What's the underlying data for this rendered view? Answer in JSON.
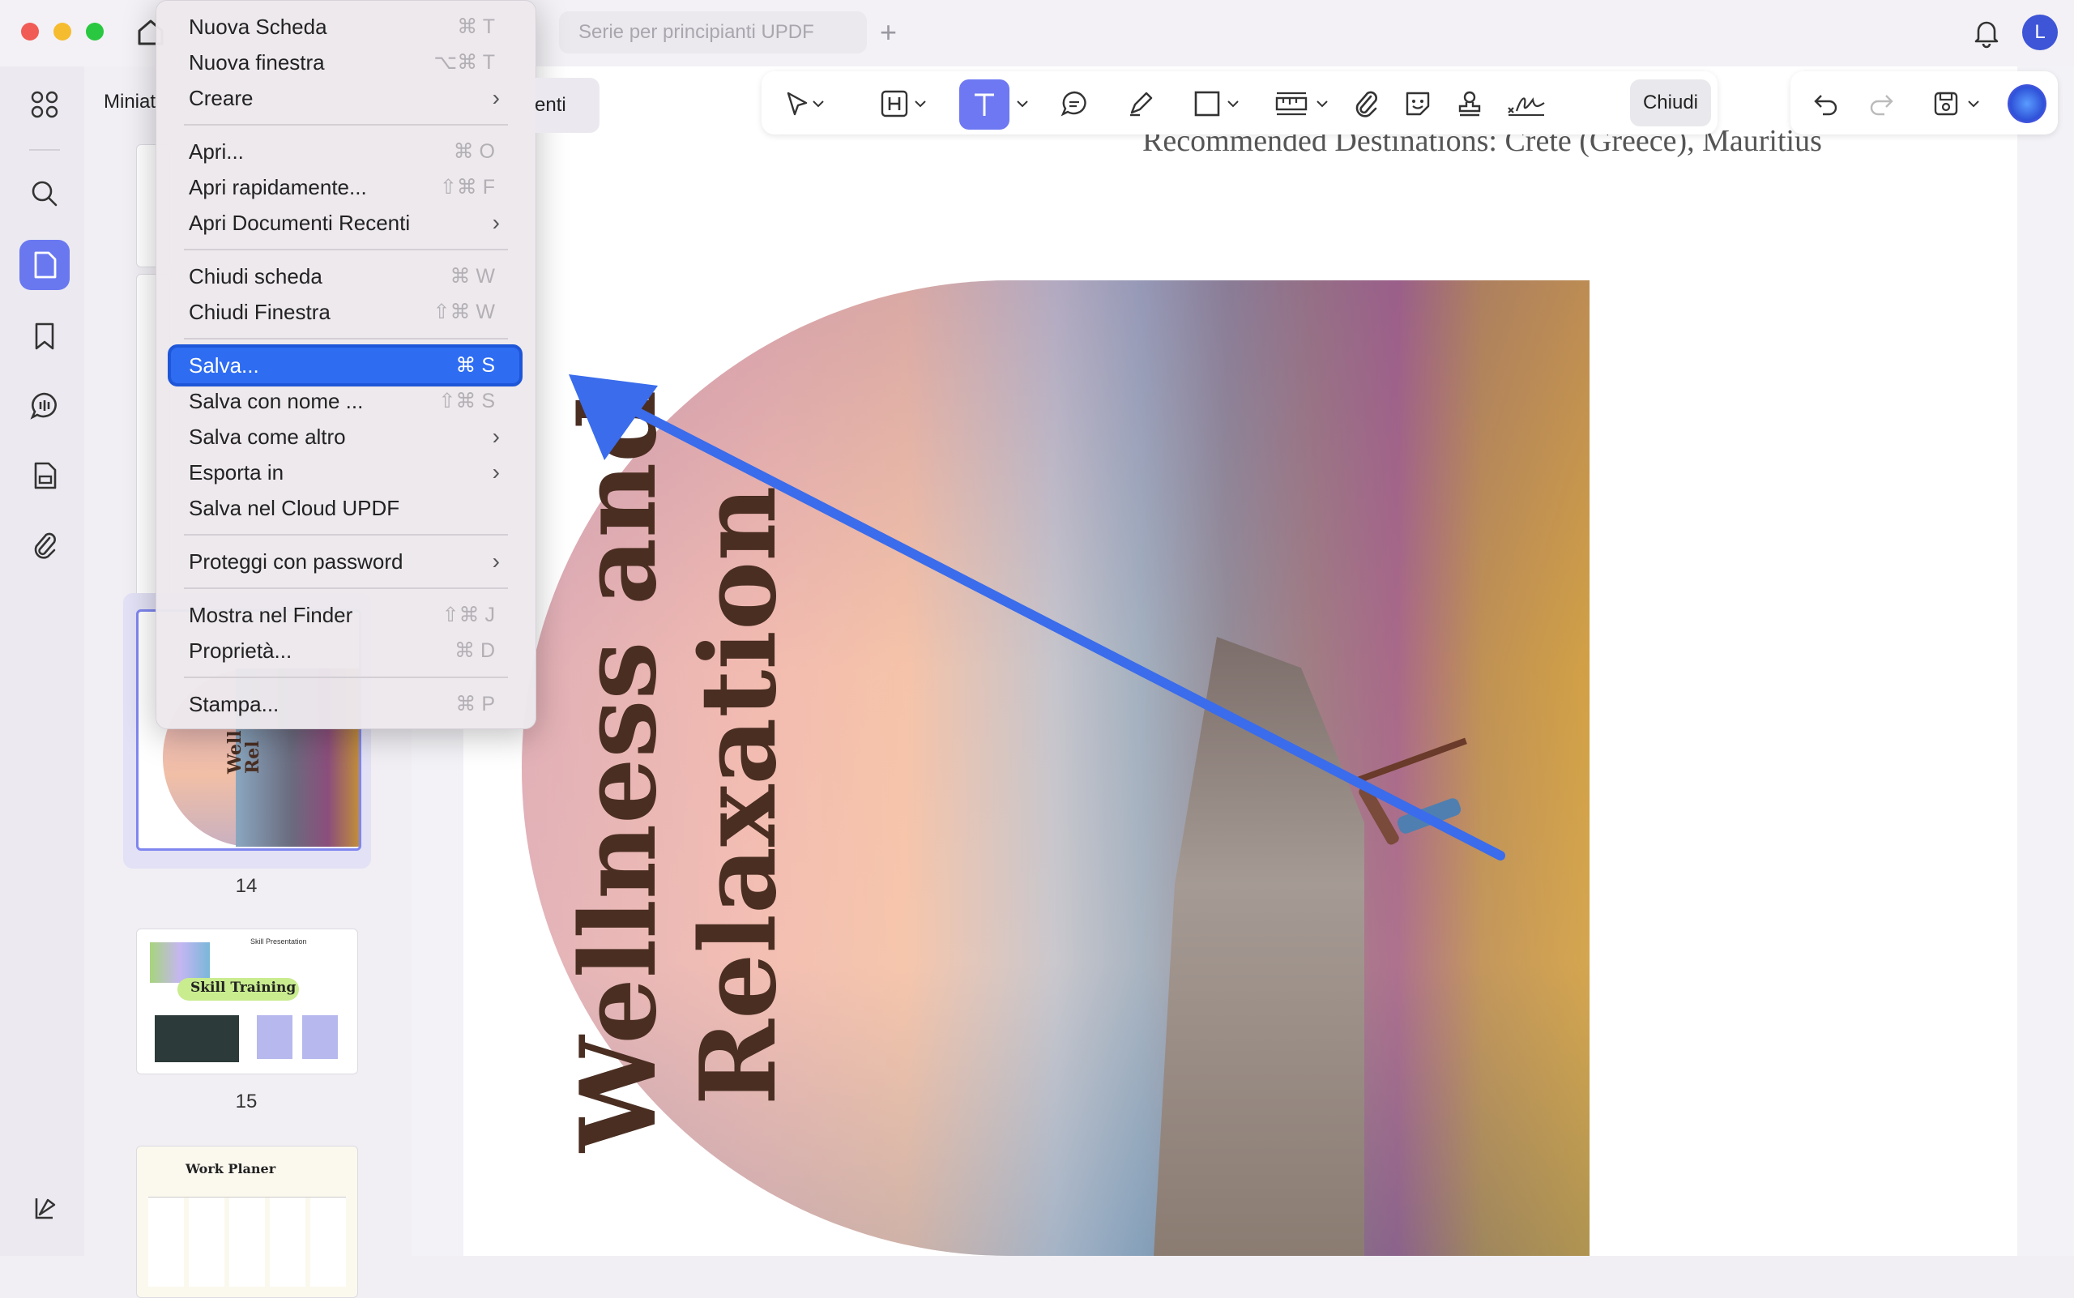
{
  "window": {
    "tab_title": "Serie per principianti UPDF",
    "avatar_letter": "L",
    "panel_title": "Miniat",
    "panel_tab_suffix": "enti"
  },
  "toolbar": {
    "close_label": "Chiudi"
  },
  "thumbnails": [
    {
      "page": "14",
      "lines": [
        "Well",
        "Rel"
      ]
    },
    {
      "page": "15",
      "title": "Skill Training",
      "subtitle": "Skill Presentation"
    },
    {
      "page": "",
      "title": "Work Planer"
    }
  ],
  "document": {
    "heading": "Recommended Destinations: Crete (Greece), Mauritius",
    "title_line1": "Wellness and",
    "title_line2": "Relaxation"
  },
  "menu": {
    "items": [
      {
        "label": "Nuova Scheda",
        "shortcut": "⌘ T"
      },
      {
        "label": "Nuova finestra",
        "shortcut": "⌥⌘ T"
      },
      {
        "label": "Creare",
        "submenu": "›"
      },
      {
        "label": "Apri...",
        "shortcut": "⌘ O"
      },
      {
        "label": "Apri rapidamente...",
        "shortcut": "⇧⌘ F"
      },
      {
        "label": "Apri Documenti Recenti",
        "submenu": "›"
      },
      {
        "label": "Chiudi scheda",
        "shortcut": "⌘ W"
      },
      {
        "label": "Chiudi Finestra",
        "shortcut": "⇧⌘ W"
      },
      {
        "label": "Salva...",
        "shortcut": "⌘ S"
      },
      {
        "label": "Salva con nome ...",
        "shortcut": "⇧⌘ S"
      },
      {
        "label": "Salva come altro",
        "submenu": "›"
      },
      {
        "label": "Esporta in",
        "submenu": "›"
      },
      {
        "label": "Salva nel Cloud UPDF"
      },
      {
        "label": "Proteggi con password",
        "submenu": "›"
      },
      {
        "label": "Mostra nel Finder",
        "shortcut": "⇧⌘ J"
      },
      {
        "label": "Proprietà...",
        "shortcut": "⌘ D"
      },
      {
        "label": "Stampa...",
        "shortcut": "⌘ P"
      }
    ]
  },
  "colors": {
    "accent": "#2e6cf2",
    "arrow": "#3a6cec",
    "title_text": "#4a2e22"
  }
}
